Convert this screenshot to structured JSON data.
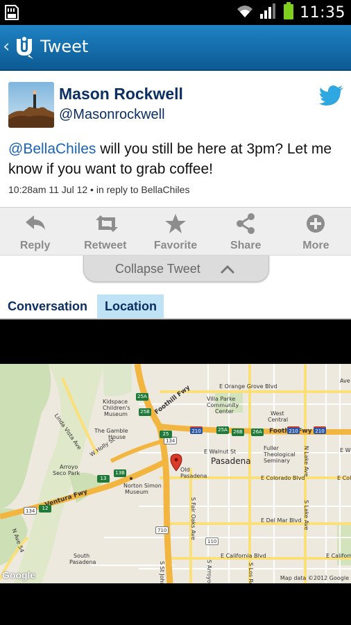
{
  "status_bar": {
    "time": "11:35"
  },
  "action_bar": {
    "title": "Tweet",
    "back_glyph": "‹"
  },
  "tweet": {
    "name": "Mason Rockwell",
    "handle": "@Masonrockwell",
    "mention": "@BellaChiles",
    "text": " will you still be here at 3pm? Let me know if you want to grab coffee!",
    "meta": "10:28am 11 Jul 12 • in reply to BellaChiles"
  },
  "actions": [
    {
      "label": "Reply",
      "icon": "reply-icon"
    },
    {
      "label": "Retweet",
      "icon": "retweet-icon"
    },
    {
      "label": "Favorite",
      "icon": "star-icon"
    },
    {
      "label": "Share",
      "icon": "share-icon"
    },
    {
      "label": "More",
      "icon": "plus-circle-icon"
    }
  ],
  "collapse_label": "Collapse Tweet",
  "tabs": [
    {
      "label": "Conversation",
      "selected": false
    },
    {
      "label": "Location",
      "selected": true
    }
  ],
  "map": {
    "labels": {
      "orange_grove": "E Orange Grove Blvd",
      "villa_parke": "Villa Parke",
      "community": "Community",
      "center": "Center",
      "west": "West",
      "central": "Central",
      "kidspace": "Kidspace",
      "childrens": "Children's",
      "museum": "Museum",
      "linda_vista": "Linda Vista Ave",
      "gamble": "The Gamble",
      "house": "House",
      "foothill_a": "Foothill Fwy",
      "foothill_b": "Foothill Fwy",
      "holly": "W Holly St",
      "walnut": "E Walnut St",
      "fuller": "Fuller",
      "theological": "Theological",
      "seminary": "Seminary",
      "pasadena": "Pasadena",
      "old_pasadena": "Old Pasadena",
      "colorado_a": "E Colorado Blvd",
      "colorado_b": "E Col",
      "ew": "E W",
      "arroyo": "Arroyo",
      "seco_park": "Seco Park",
      "norton": "Norton Simon",
      "norton_museum": "Museum",
      "ventura": "Ventura Fwy",
      "lake": "N Lake Ave",
      "s_lake": "S Lake Ave",
      "del_mar": "E Del Mar Blvd",
      "fair_oaks": "S Fair Oaks Ave",
      "california_a": "E California Blvd",
      "california_b": "E California",
      "s_arroyo": "S Arroyo",
      "s_los_robles": "S Los Robles",
      "s_john": "S St John",
      "n_ave_54": "N Ave 54",
      "south": "South",
      "pasadena_south": "Pasadena",
      "ave": "Ave"
    },
    "shields": {
      "i210_a": "210",
      "i210_b": "210",
      "i210_c": "210",
      "r134_a": "134",
      "r134_b": "134",
      "r110": "110",
      "r710": "710",
      "e25a": "25A",
      "e26b": "26B",
      "e26a": "26A",
      "e25a_b": "25A",
      "e25b": "25B",
      "e13b": "13B",
      "e13": "13",
      "e12": "12",
      "e25": "25"
    },
    "google": "Google",
    "attribution": "Map data ©2012 Google"
  },
  "colors": {
    "action_bar": "#1f83c4",
    "link": "#1a62b6",
    "name": "#0b2e63",
    "selected_tab": "#bfe3f4",
    "freeway": "#f2b640"
  }
}
